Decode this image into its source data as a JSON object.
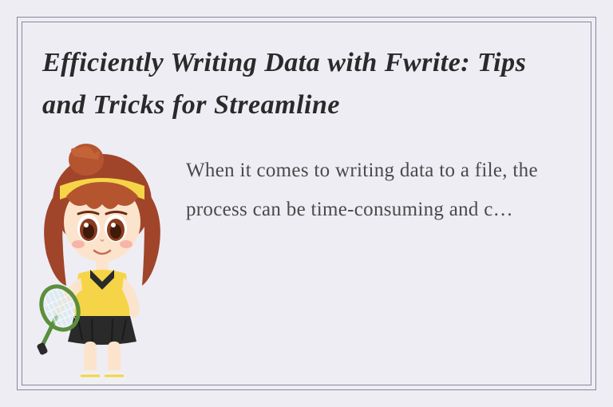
{
  "card": {
    "title": "Efficiently Writing Data with Fwrite: Tips and Tricks for Streamline",
    "excerpt": "When it comes to writing data to a file, the process can be time-consuming and c…",
    "avatar_alt": "cartoon-girl-tennis-player"
  }
}
